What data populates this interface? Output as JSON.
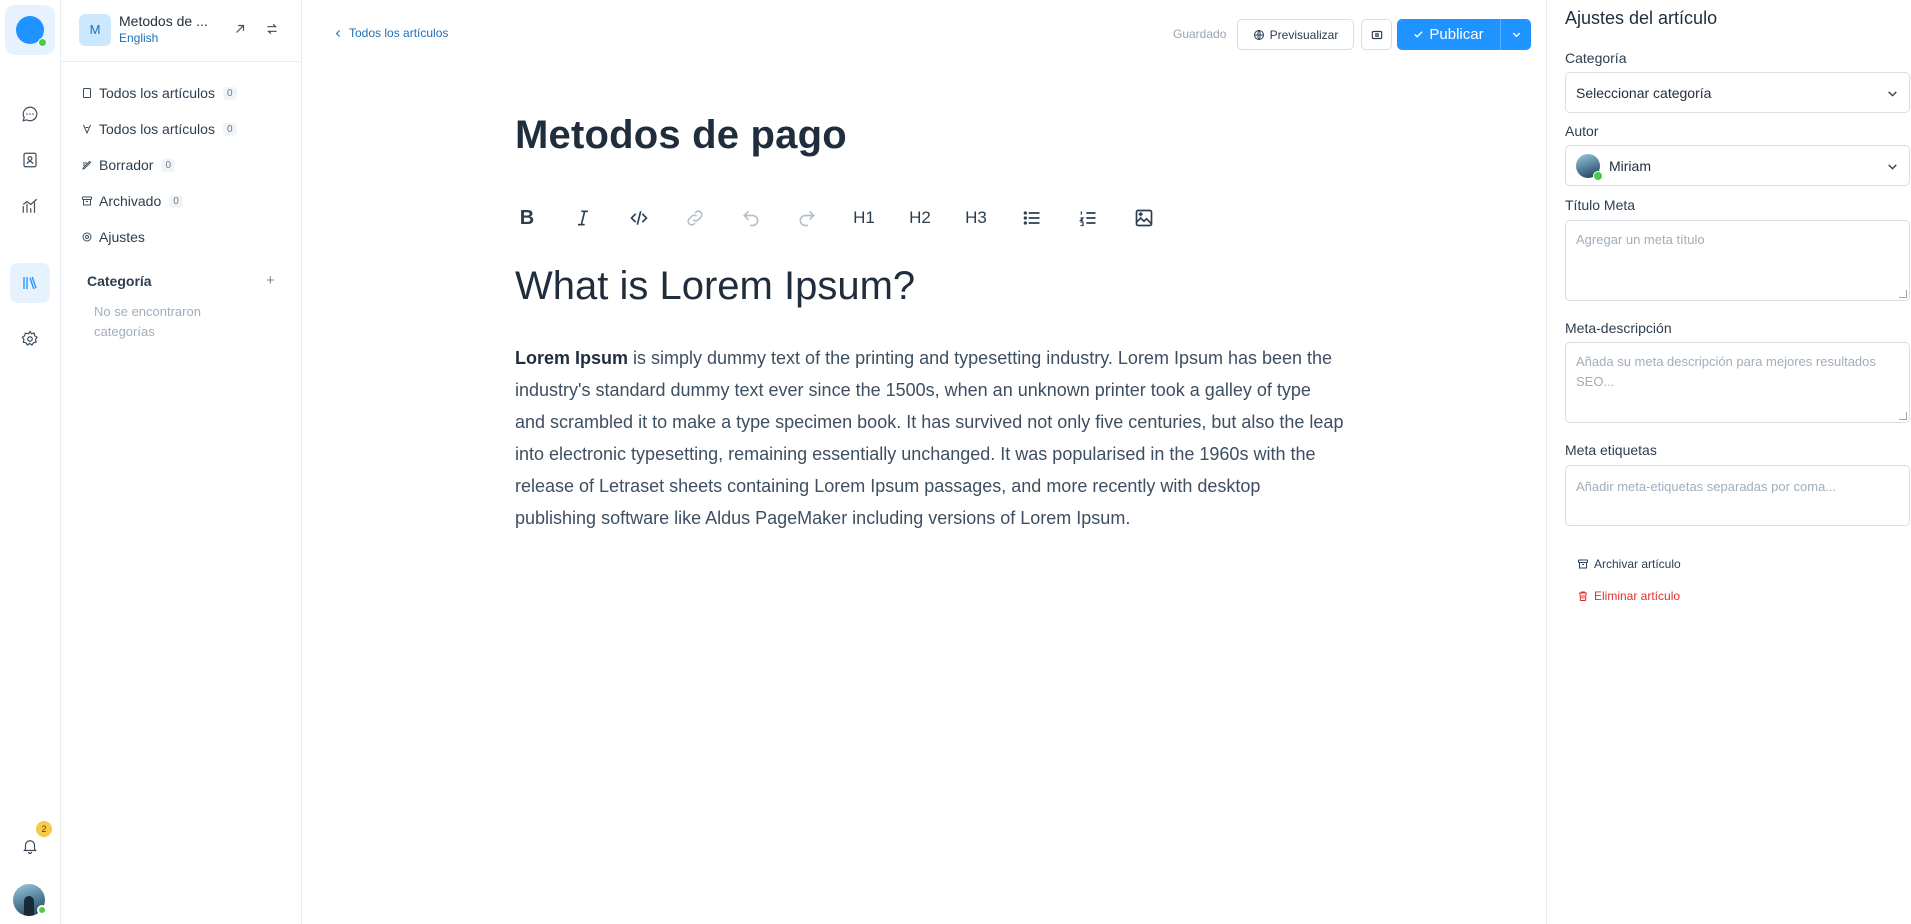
{
  "rail": {
    "items": [
      "conversations",
      "contacts",
      "reports",
      "help-center",
      "settings"
    ],
    "notification_count": "2"
  },
  "portal": {
    "avatar_letter": "M",
    "name": "Metodos de ...",
    "locale": "English"
  },
  "sidebar": {
    "items": [
      {
        "label": "Todos los artículos",
        "count": "0",
        "icon": "book-icon"
      },
      {
        "label": "Todos los artículos",
        "count": "0",
        "icon": "pen-nib-icon"
      },
      {
        "label": "Borrador",
        "count": "0",
        "icon": "draft-icon"
      },
      {
        "label": "Archivado",
        "count": "0",
        "icon": "archive-icon"
      },
      {
        "label": "Ajustes",
        "icon": "gear-icon"
      }
    ],
    "category_title": "Categoría",
    "category_add": "+",
    "category_empty": "No se encontraron categorías"
  },
  "header": {
    "back_label": "Todos los artículos",
    "saved_label": "Guardado",
    "preview_label": "Previsualizar",
    "publish_label": "Publicar"
  },
  "editor": {
    "title": "Metodos de pago",
    "toolbar": [
      "B",
      "I",
      "code",
      "link",
      "undo",
      "redo",
      "H1",
      "H2",
      "H3",
      "bullet-list",
      "ordered-list",
      "image"
    ],
    "heading": "What is Lorem Ipsum?",
    "para_bold": "Lorem Ipsum",
    "para_rest": " is simply dummy text of the printing and typesetting industry. Lorem Ipsum has been the industry's standard dummy text ever since the 1500s, when an unknown printer took a galley of type and scrambled it to make a type specimen book. It has survived not only five centuries, but also the leap into electronic typesetting, remaining essentially unchanged. It was popularised in the 1960s with the release of Letraset sheets containing Lorem Ipsum passages, and more recently with desktop publishing software like Aldus PageMaker including versions of Lorem Ipsum."
  },
  "panel": {
    "title": "Ajustes del artículo",
    "category_label": "Categoría",
    "category_value": "Seleccionar categoría",
    "author_label": "Autor",
    "author_value": "Miriam",
    "meta_title_label": "Título Meta",
    "meta_title_placeholder": "Agregar un meta título",
    "meta_desc_label": "Meta-descripción",
    "meta_desc_placeholder": "Añada su meta descripción para mejores resultados SEO...",
    "meta_tags_label": "Meta etiquetas",
    "meta_tags_placeholder": "Añadir meta-etiquetas separadas por coma...",
    "archive_label": "Archivar artículo",
    "delete_label": "Eliminar artículo"
  },
  "colors": {
    "accent": "#1f93ff",
    "danger": "#e0302b",
    "online": "#44ce4b",
    "badge": "#f7c948"
  }
}
